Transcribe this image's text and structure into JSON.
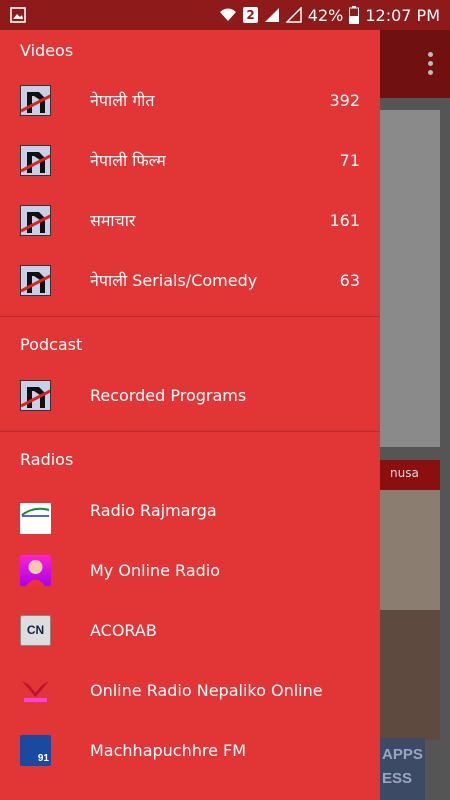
{
  "status_bar": {
    "sim_slot": "2",
    "battery": "42%",
    "time": "12:07 PM",
    "icons": [
      "image-icon",
      "wifi-icon",
      "signal-icon",
      "battery-icon"
    ]
  },
  "drawer": {
    "videos": {
      "header": "Videos",
      "items": [
        {
          "label": "नेपाली गीत",
          "count": "392",
          "icon": "channel-logo-icon"
        },
        {
          "label": "नेपाली फिल्म",
          "count": "71",
          "icon": "channel-logo-icon"
        },
        {
          "label": "समाचार",
          "count": "161",
          "icon": "channel-logo-icon"
        },
        {
          "label": "नेपाली Serials/Comedy",
          "count": "63",
          "icon": "channel-logo-icon"
        }
      ]
    },
    "podcast": {
      "header": "Podcast",
      "items": [
        {
          "label": "Recorded Programs",
          "icon": "channel-logo-icon"
        }
      ]
    },
    "radios": {
      "header": "Radios",
      "items": [
        {
          "label": "Radio Rajmarga",
          "icon": "radio-rajmarga-icon"
        },
        {
          "label": "My Online Radio",
          "icon": "my-online-radio-icon"
        },
        {
          "label": "ACORAB",
          "icon": "acorab-icon",
          "icon_text": "CN"
        },
        {
          "label": "Online Radio Nepaliko Online",
          "icon": "nepaliko-icon"
        },
        {
          "label": "Machhapuchhre FM",
          "icon": "machhapuchhre-icon",
          "icon_text": "91"
        }
      ]
    }
  },
  "background": {
    "banner_text_1": "APPS",
    "banner_text_2": "ESS",
    "card_caption": "nusa",
    "menu_icon": "overflow-menu-icon"
  },
  "colors": {
    "drawer_bg": "#e13536",
    "status_bar": "#8f1a1a",
    "toolbar_dim": "#701010"
  }
}
